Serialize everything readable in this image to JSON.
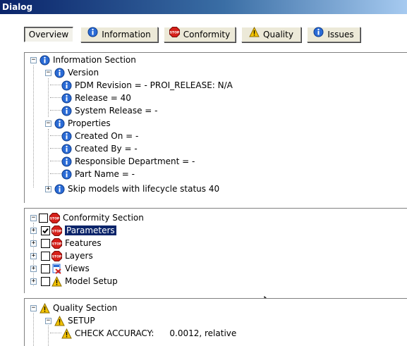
{
  "window": {
    "title": "Dialog"
  },
  "tabs": [
    {
      "label": "Overview",
      "icon": "none",
      "active": true
    },
    {
      "label": "Information",
      "icon": "info-icon"
    },
    {
      "label": "Conformity",
      "icon": "stop-icon"
    },
    {
      "label": "Quality",
      "icon": "warning-icon"
    },
    {
      "label": "Issues",
      "icon": "info-icon"
    }
  ],
  "information": {
    "section_label": "Information Section",
    "version": {
      "label": "Version",
      "items": [
        "PDM Revision = - PROI_RELEASE: N/A",
        "Release = 40",
        "System Release = -"
      ]
    },
    "properties": {
      "label": "Properties",
      "items": [
        "Created On = -",
        "Created By = -",
        "Responsible Department = -",
        "Part Name = -"
      ]
    },
    "skip_label": "Skip models with lifecycle status 40"
  },
  "conformity": {
    "section_label": "Conformity Section",
    "items": [
      {
        "label": "Parameters",
        "checked": true,
        "selected": true,
        "icon": "stop-icon"
      },
      {
        "label": "Features",
        "checked": false,
        "icon": "stop-icon"
      },
      {
        "label": "Layers",
        "checked": false,
        "icon": "stop-icon"
      },
      {
        "label": "Views",
        "checked": false,
        "icon": "view-error-icon"
      },
      {
        "label": "Model Setup",
        "checked": false,
        "icon": "warning-icon"
      }
    ]
  },
  "quality": {
    "section_label": "Quality Section",
    "setup_label": "SETUP",
    "check_label": "CHECK ACCURACY:",
    "check_value": "0.0012, relative"
  },
  "colors": {
    "selection": "#0a246a",
    "stop": "#d6201a",
    "warning": "#f5c400",
    "info": "#2a6bd6"
  }
}
